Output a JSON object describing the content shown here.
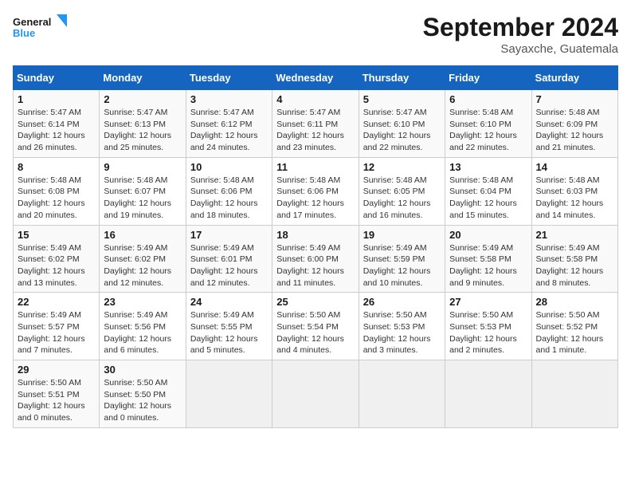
{
  "logo": {
    "line1": "General",
    "line2": "Blue"
  },
  "title": "September 2024",
  "location": "Sayaxche, Guatemala",
  "weekdays": [
    "Sunday",
    "Monday",
    "Tuesday",
    "Wednesday",
    "Thursday",
    "Friday",
    "Saturday"
  ],
  "weeks": [
    [
      {
        "day": "1",
        "info": "Sunrise: 5:47 AM\nSunset: 6:14 PM\nDaylight: 12 hours\nand 26 minutes."
      },
      {
        "day": "2",
        "info": "Sunrise: 5:47 AM\nSunset: 6:13 PM\nDaylight: 12 hours\nand 25 minutes."
      },
      {
        "day": "3",
        "info": "Sunrise: 5:47 AM\nSunset: 6:12 PM\nDaylight: 12 hours\nand 24 minutes."
      },
      {
        "day": "4",
        "info": "Sunrise: 5:47 AM\nSunset: 6:11 PM\nDaylight: 12 hours\nand 23 minutes."
      },
      {
        "day": "5",
        "info": "Sunrise: 5:47 AM\nSunset: 6:10 PM\nDaylight: 12 hours\nand 22 minutes."
      },
      {
        "day": "6",
        "info": "Sunrise: 5:48 AM\nSunset: 6:10 PM\nDaylight: 12 hours\nand 22 minutes."
      },
      {
        "day": "7",
        "info": "Sunrise: 5:48 AM\nSunset: 6:09 PM\nDaylight: 12 hours\nand 21 minutes."
      }
    ],
    [
      {
        "day": "8",
        "info": "Sunrise: 5:48 AM\nSunset: 6:08 PM\nDaylight: 12 hours\nand 20 minutes."
      },
      {
        "day": "9",
        "info": "Sunrise: 5:48 AM\nSunset: 6:07 PM\nDaylight: 12 hours\nand 19 minutes."
      },
      {
        "day": "10",
        "info": "Sunrise: 5:48 AM\nSunset: 6:06 PM\nDaylight: 12 hours\nand 18 minutes."
      },
      {
        "day": "11",
        "info": "Sunrise: 5:48 AM\nSunset: 6:06 PM\nDaylight: 12 hours\nand 17 minutes."
      },
      {
        "day": "12",
        "info": "Sunrise: 5:48 AM\nSunset: 6:05 PM\nDaylight: 12 hours\nand 16 minutes."
      },
      {
        "day": "13",
        "info": "Sunrise: 5:48 AM\nSunset: 6:04 PM\nDaylight: 12 hours\nand 15 minutes."
      },
      {
        "day": "14",
        "info": "Sunrise: 5:48 AM\nSunset: 6:03 PM\nDaylight: 12 hours\nand 14 minutes."
      }
    ],
    [
      {
        "day": "15",
        "info": "Sunrise: 5:49 AM\nSunset: 6:02 PM\nDaylight: 12 hours\nand 13 minutes."
      },
      {
        "day": "16",
        "info": "Sunrise: 5:49 AM\nSunset: 6:02 PM\nDaylight: 12 hours\nand 12 minutes."
      },
      {
        "day": "17",
        "info": "Sunrise: 5:49 AM\nSunset: 6:01 PM\nDaylight: 12 hours\nand 12 minutes."
      },
      {
        "day": "18",
        "info": "Sunrise: 5:49 AM\nSunset: 6:00 PM\nDaylight: 12 hours\nand 11 minutes."
      },
      {
        "day": "19",
        "info": "Sunrise: 5:49 AM\nSunset: 5:59 PM\nDaylight: 12 hours\nand 10 minutes."
      },
      {
        "day": "20",
        "info": "Sunrise: 5:49 AM\nSunset: 5:58 PM\nDaylight: 12 hours\nand 9 minutes."
      },
      {
        "day": "21",
        "info": "Sunrise: 5:49 AM\nSunset: 5:58 PM\nDaylight: 12 hours\nand 8 minutes."
      }
    ],
    [
      {
        "day": "22",
        "info": "Sunrise: 5:49 AM\nSunset: 5:57 PM\nDaylight: 12 hours\nand 7 minutes."
      },
      {
        "day": "23",
        "info": "Sunrise: 5:49 AM\nSunset: 5:56 PM\nDaylight: 12 hours\nand 6 minutes."
      },
      {
        "day": "24",
        "info": "Sunrise: 5:49 AM\nSunset: 5:55 PM\nDaylight: 12 hours\nand 5 minutes."
      },
      {
        "day": "25",
        "info": "Sunrise: 5:50 AM\nSunset: 5:54 PM\nDaylight: 12 hours\nand 4 minutes."
      },
      {
        "day": "26",
        "info": "Sunrise: 5:50 AM\nSunset: 5:53 PM\nDaylight: 12 hours\nand 3 minutes."
      },
      {
        "day": "27",
        "info": "Sunrise: 5:50 AM\nSunset: 5:53 PM\nDaylight: 12 hours\nand 2 minutes."
      },
      {
        "day": "28",
        "info": "Sunrise: 5:50 AM\nSunset: 5:52 PM\nDaylight: 12 hours\nand 1 minute."
      }
    ],
    [
      {
        "day": "29",
        "info": "Sunrise: 5:50 AM\nSunset: 5:51 PM\nDaylight: 12 hours\nand 0 minutes."
      },
      {
        "day": "30",
        "info": "Sunrise: 5:50 AM\nSunset: 5:50 PM\nDaylight: 12 hours\nand 0 minutes."
      },
      {
        "day": "",
        "info": ""
      },
      {
        "day": "",
        "info": ""
      },
      {
        "day": "",
        "info": ""
      },
      {
        "day": "",
        "info": ""
      },
      {
        "day": "",
        "info": ""
      }
    ]
  ]
}
